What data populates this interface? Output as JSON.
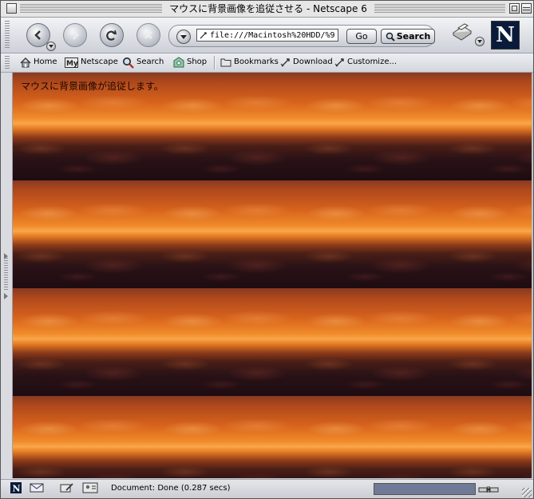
{
  "window": {
    "title": "マウスに背景画像を追従させる - Netscape 6"
  },
  "navbar": {
    "url": "file:///Macintosh%20HDD/%9",
    "go_label": "Go",
    "search_label": "Search",
    "brand_letter": "N"
  },
  "personal_toolbar": {
    "items": [
      {
        "label": "Home",
        "icon": "home-icon"
      },
      {
        "label": "Netscape",
        "icon": "my-netscape-icon"
      },
      {
        "label": "Search",
        "icon": "search-icon"
      },
      {
        "label": "Shop",
        "icon": "shop-icon"
      },
      {
        "label": "Bookmarks",
        "icon": "folder-icon"
      },
      {
        "label": "Download",
        "icon": "bookmark-link-icon"
      },
      {
        "label": "Customize...",
        "icon": "bookmark-link-icon"
      }
    ]
  },
  "page": {
    "text": "マウスに背景画像が追従します。"
  },
  "statusbar": {
    "status": "Document: Done (0.287 secs)",
    "progress": 1.0
  },
  "colors": {
    "sky_top": "#8a3a20",
    "horizon": "#f9a64a",
    "ground": "#1e0c12",
    "chrome": "#d3d6dc"
  }
}
